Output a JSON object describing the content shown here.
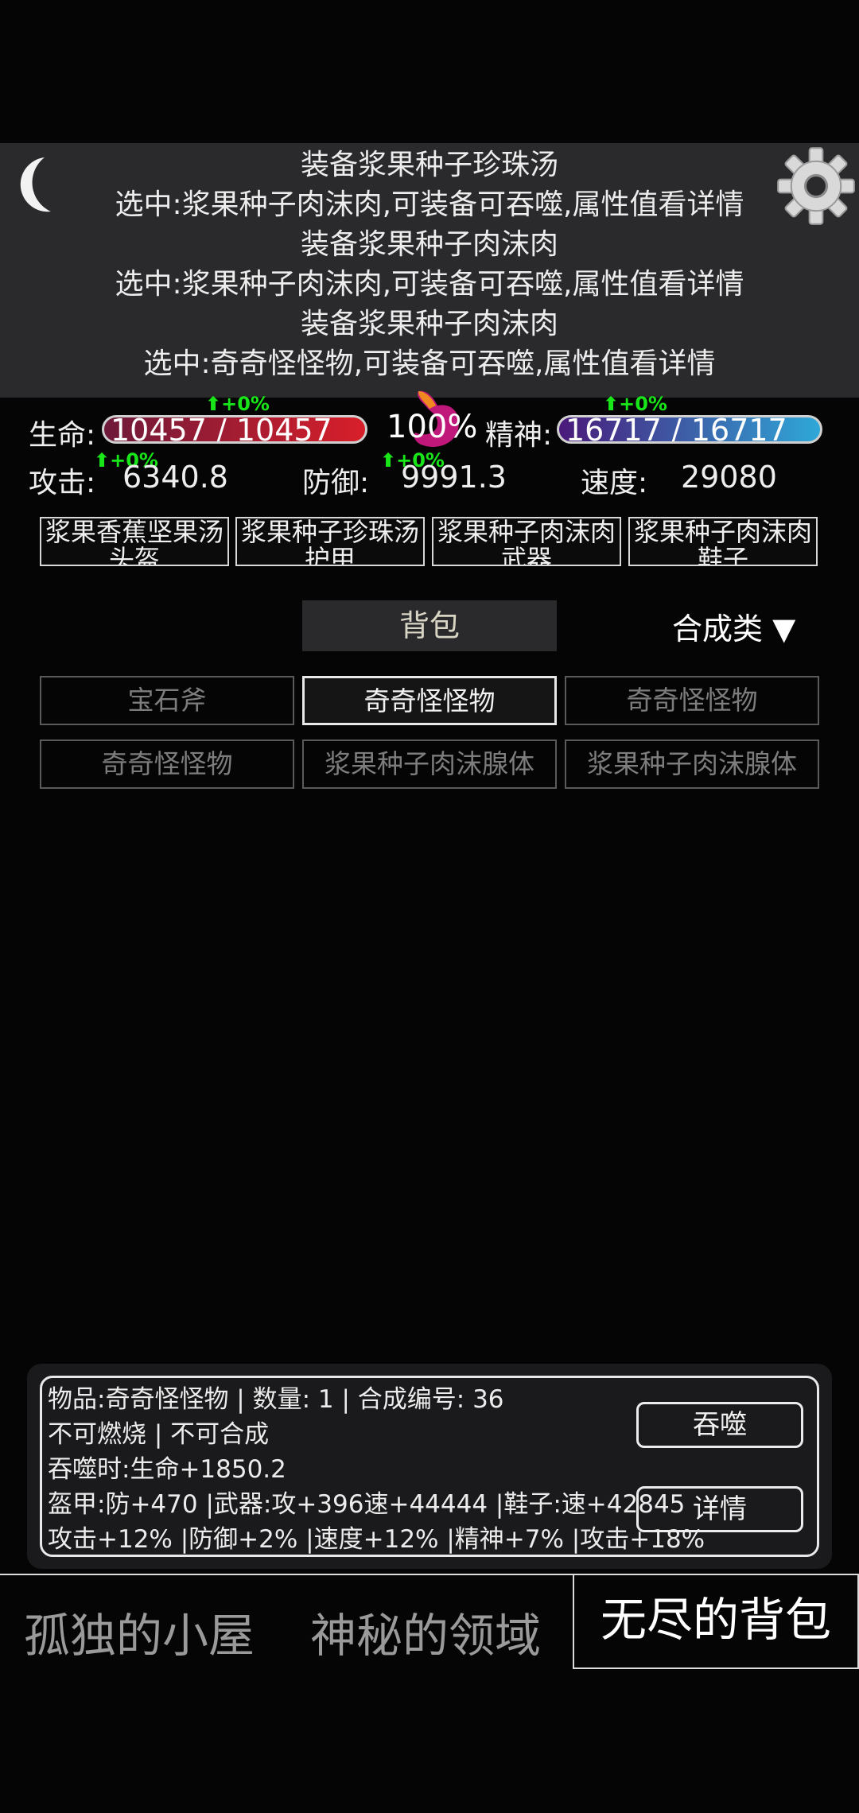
{
  "log": {
    "lines": [
      "装备浆果种子珍珠汤",
      "选中:浆果种子肉沫肉,可装备可吞噬,属性值看详情",
      "装备浆果种子肉沫肉",
      "选中:浆果种子肉沫肉,可装备可吞噬,属性值看详情",
      "装备浆果种子肉沫肉",
      "选中:奇奇怪怪物,可装备可吞噬,属性值看详情"
    ]
  },
  "stats": {
    "life_label": "生命:",
    "life_value": "10457 / 10457",
    "life_delta": "+0%",
    "hunger_percent": "100%",
    "spirit_label": "精神:",
    "spirit_value": "16717 / 16717",
    "spirit_delta": "+0%",
    "attack_label": "攻击:",
    "attack_value": "6340.8",
    "attack_delta": "+0%",
    "defense_label": "防御:",
    "defense_value": "9991.3",
    "defense_delta": "+0%",
    "speed_label": "速度:",
    "speed_value": "29080"
  },
  "equipment": [
    "浆果香蕉坚果汤头盔",
    "浆果种子珍珠汤护甲",
    "浆果种子肉沫肉武器",
    "浆果种子肉沫肉鞋子"
  ],
  "bag": {
    "tab_label": "背包",
    "sort_label": "合成类 ▼",
    "items": [
      {
        "name": "宝石斧",
        "selected": false
      },
      {
        "name": "奇奇怪怪物",
        "selected": true
      },
      {
        "name": "奇奇怪怪物",
        "selected": false
      },
      {
        "name": "奇奇怪怪物",
        "selected": false
      },
      {
        "name": "浆果种子肉沫腺体",
        "selected": false
      },
      {
        "name": "浆果种子肉沫腺体",
        "selected": false
      }
    ]
  },
  "info": {
    "line1": "物品:奇奇怪怪物 | 数量: 1 | 合成编号: 36",
    "line2": "不可燃烧 | 不可合成",
    "line3": "吞噬时:生命+1850.2",
    "line4": "盔甲:防+470 |武器:攻+396速+44444 |鞋子:速+42845",
    "line5": "攻击+12% |防御+2% |速度+12% |精神+7% |攻击+18%",
    "devour_label": "吞噬",
    "detail_label": "详情"
  },
  "nav": {
    "tab1": "孤独的小屋",
    "tab2": "神秘的领域",
    "tab3": "无尽的背包"
  },
  "colors": {
    "life_bar_start": "#6e1a3a",
    "life_bar_end": "#d81f2a",
    "spirit_bar_start": "#4a1a7a",
    "spirit_bar_end": "#2fa8d8",
    "delta_green": "#19e619"
  }
}
